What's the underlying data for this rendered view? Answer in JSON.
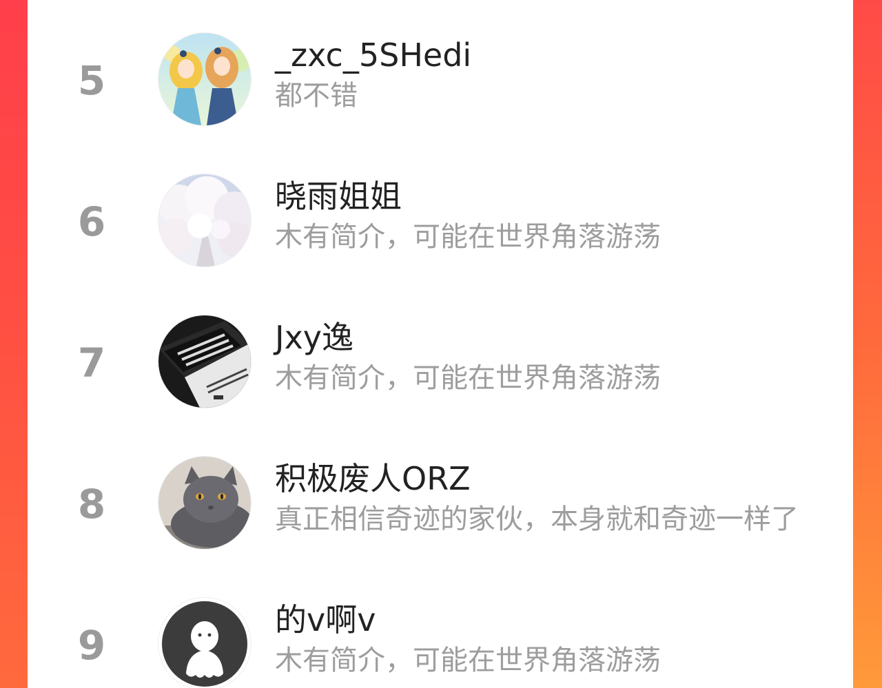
{
  "colors": {
    "background_accent": "#ff5040",
    "rank_color": "#9a9a9a",
    "name_color": "#222222",
    "bio_color": "#9d9d9d"
  },
  "users": [
    {
      "rank": "5",
      "name": "_zxc_5SHedi",
      "bio": "都不错",
      "avatar": "anime-girls-avatar"
    },
    {
      "rank": "6",
      "name": "晓雨姐姐",
      "bio": "木有简介，可能在世界角落游荡",
      "avatar": "snowy-trees-avatar"
    },
    {
      "rank": "7",
      "name": "Jxy逸",
      "bio": "木有简介，可能在世界角落游荡",
      "avatar": "album-box-avatar"
    },
    {
      "rank": "8",
      "name": "积极废人ORZ",
      "bio": "真正相信奇迹的家伙，本身就和奇迹一样了",
      "avatar": "gray-cat-avatar"
    },
    {
      "rank": "9",
      "name": "的v啊v",
      "bio": "木有简介，可能在世界角落游荡",
      "avatar": "default-ghost-avatar"
    }
  ]
}
